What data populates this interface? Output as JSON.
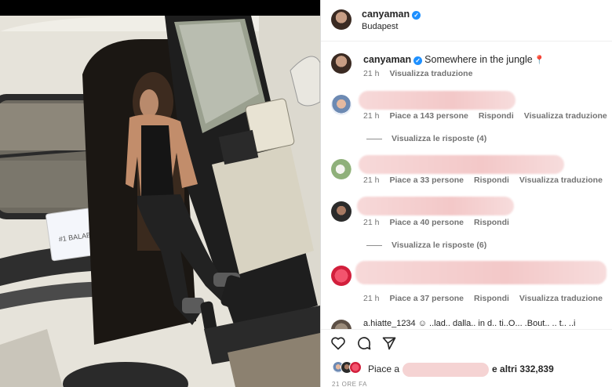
{
  "post": {
    "author": "canyaman",
    "location": "Budapest",
    "photo_sign": "#1 BALABAN"
  },
  "caption": {
    "author": "canyaman",
    "text": "Somewhere in the jungle",
    "time": "21 h",
    "translate": "Visualizza traduzione"
  },
  "comments": [
    {
      "time": "21 h",
      "likes": "Piace a 143 persone",
      "reply": "Rispondi",
      "translate": "Visualizza traduzione",
      "replies": "Visualizza le risposte (4)"
    },
    {
      "time": "21 h",
      "likes": "Piace a 33 persone",
      "reply": "Rispondi",
      "translate": "Visualizza traduzione"
    },
    {
      "time": "21 h",
      "likes": "Piace a 40 persone",
      "reply": "Rispondi",
      "replies": "Visualizza le risposte (6)"
    },
    {
      "time": "21 h",
      "likes": "Piace a 37 persone",
      "reply": "Rispondi",
      "translate": "Visualizza traduzione"
    }
  ],
  "partial_comment": "a.hiatte_1234 ☺ ..lad.. dalla.. in d.. ti..O...  .Bout.. .. t..  ..i",
  "footer": {
    "likes_prefix": "Piace a",
    "likes_suffix": "e altri",
    "likes_count": "332,839",
    "date": "21 ORE FA"
  },
  "icons": {
    "verified": "verified-badge-icon",
    "like": "heart-icon",
    "comment": "comment-icon",
    "share": "send-icon",
    "location_pin": "pin-icon"
  },
  "colors": {
    "verified": "#1e90ff",
    "text": "#262626",
    "muted": "#737373"
  }
}
